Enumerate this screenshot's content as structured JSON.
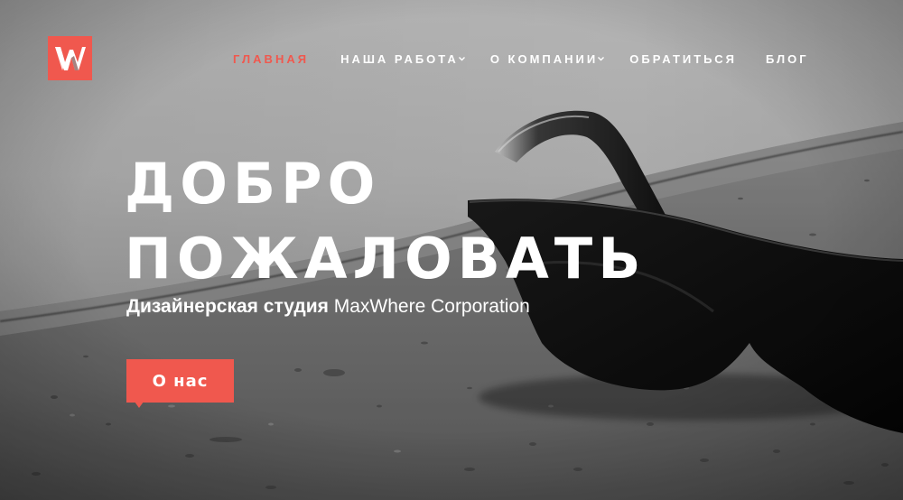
{
  "brand": {
    "logo_letter": "W",
    "accent_color": "#f0584e"
  },
  "nav": {
    "items": [
      {
        "label": "ГЛАВНАЯ",
        "active": true,
        "dropdown": false
      },
      {
        "label": "НАША РАБОТА",
        "active": false,
        "dropdown": true
      },
      {
        "label": "О КОМПАНИИ",
        "active": false,
        "dropdown": true
      },
      {
        "label": "ОБРАТИТЬСЯ",
        "active": false,
        "dropdown": false
      },
      {
        "label": "БЛОГ",
        "active": false,
        "dropdown": false
      }
    ],
    "dropdown_icon": "chevron-down-icon"
  },
  "hero": {
    "title_line1": "ДОБРО",
    "title_line2": "ПОЖАЛОВАТЬ",
    "subtitle_strong": "Дизайнерская студия",
    "subtitle_rest": " MaxWhere Corporation",
    "cta_label": "О нас",
    "background": "black-and-white photo of sunglasses on a concrete ledge"
  }
}
